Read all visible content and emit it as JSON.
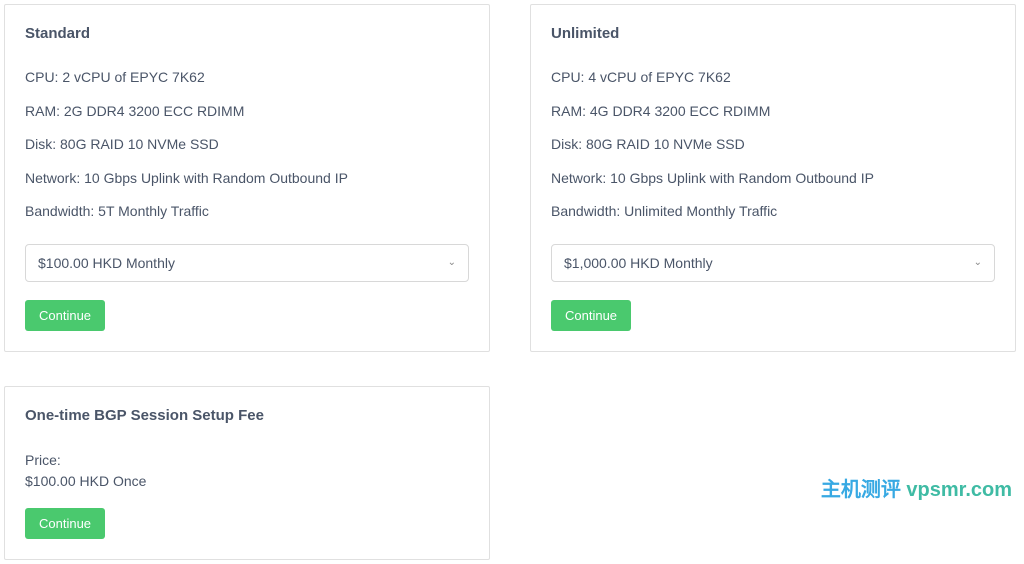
{
  "plans": [
    {
      "title": "Standard",
      "specs": [
        "CPU: 2 vCPU of EPYC 7K62",
        "RAM: 2G DDR4 3200 ECC RDIMM",
        "Disk: 80G RAID 10 NVMe SSD",
        "Network: 10 Gbps Uplink with Random Outbound IP",
        "Bandwidth: 5T Monthly Traffic"
      ],
      "selected_price": "$100.00 HKD Monthly",
      "button": "Continue"
    },
    {
      "title": "Unlimited",
      "specs": [
        "CPU: 4 vCPU of EPYC 7K62",
        "RAM: 4G DDR4 3200 ECC RDIMM",
        "Disk: 80G RAID 10 NVMe SSD",
        "Network: 10 Gbps Uplink with Random Outbound IP",
        "Bandwidth: Unlimited Monthly Traffic"
      ],
      "selected_price": "$1,000.00 HKD Monthly",
      "button": "Continue"
    }
  ],
  "addon": {
    "title": "One-time BGP Session Setup Fee",
    "price_label": "Price:",
    "price_value": "$100.00 HKD Once",
    "button": "Continue"
  },
  "watermark": {
    "cn": "主机测评",
    "en": "vpsmr.com"
  }
}
